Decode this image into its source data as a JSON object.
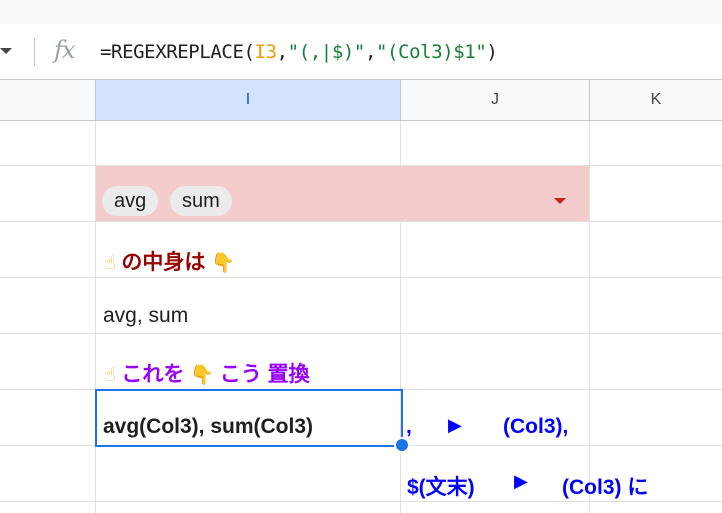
{
  "formula_bar": {
    "fx_icon": "fx",
    "formula_prefix": "=REGEXREPLACE(",
    "formula_ref": "I3",
    "formula_comma1": ",",
    "formula_pattern": "\"(,|$)\"",
    "formula_comma2": ",",
    "formula_replacement": "\"(Col3)$1\"",
    "formula_suffix": ")"
  },
  "columns": [
    {
      "label": "I",
      "selected": true
    },
    {
      "label": "J",
      "selected": false
    },
    {
      "label": "K",
      "selected": false
    }
  ],
  "chips": [
    "avg",
    "sum"
  ],
  "cells": {
    "row_label1_text": "の中身は",
    "row_value_text": "avg, sum",
    "row_label2_part1": "これを",
    "row_label2_part2": "こう 置換",
    "active_cell_text": "avg(Col3), sum(Col3)",
    "note1_left": ",",
    "note1_right": "(Col3),",
    "note2_left": "$(文末)",
    "note2_right": "(Col3) に"
  },
  "icons": {
    "pointing_up_hand": "pointing-up-hand-icon",
    "pointing_down_hand": "pointing-down-hand-icon",
    "play_arrow": "play-arrow-icon"
  },
  "colors": {
    "selected_column_header": "#d3e3fd",
    "chip_cell_fill": "#f4cccc",
    "label1_text": "#990000",
    "label2_text": "#9900ff",
    "note_text": "#0000ff",
    "selection": "#1a73e8"
  }
}
